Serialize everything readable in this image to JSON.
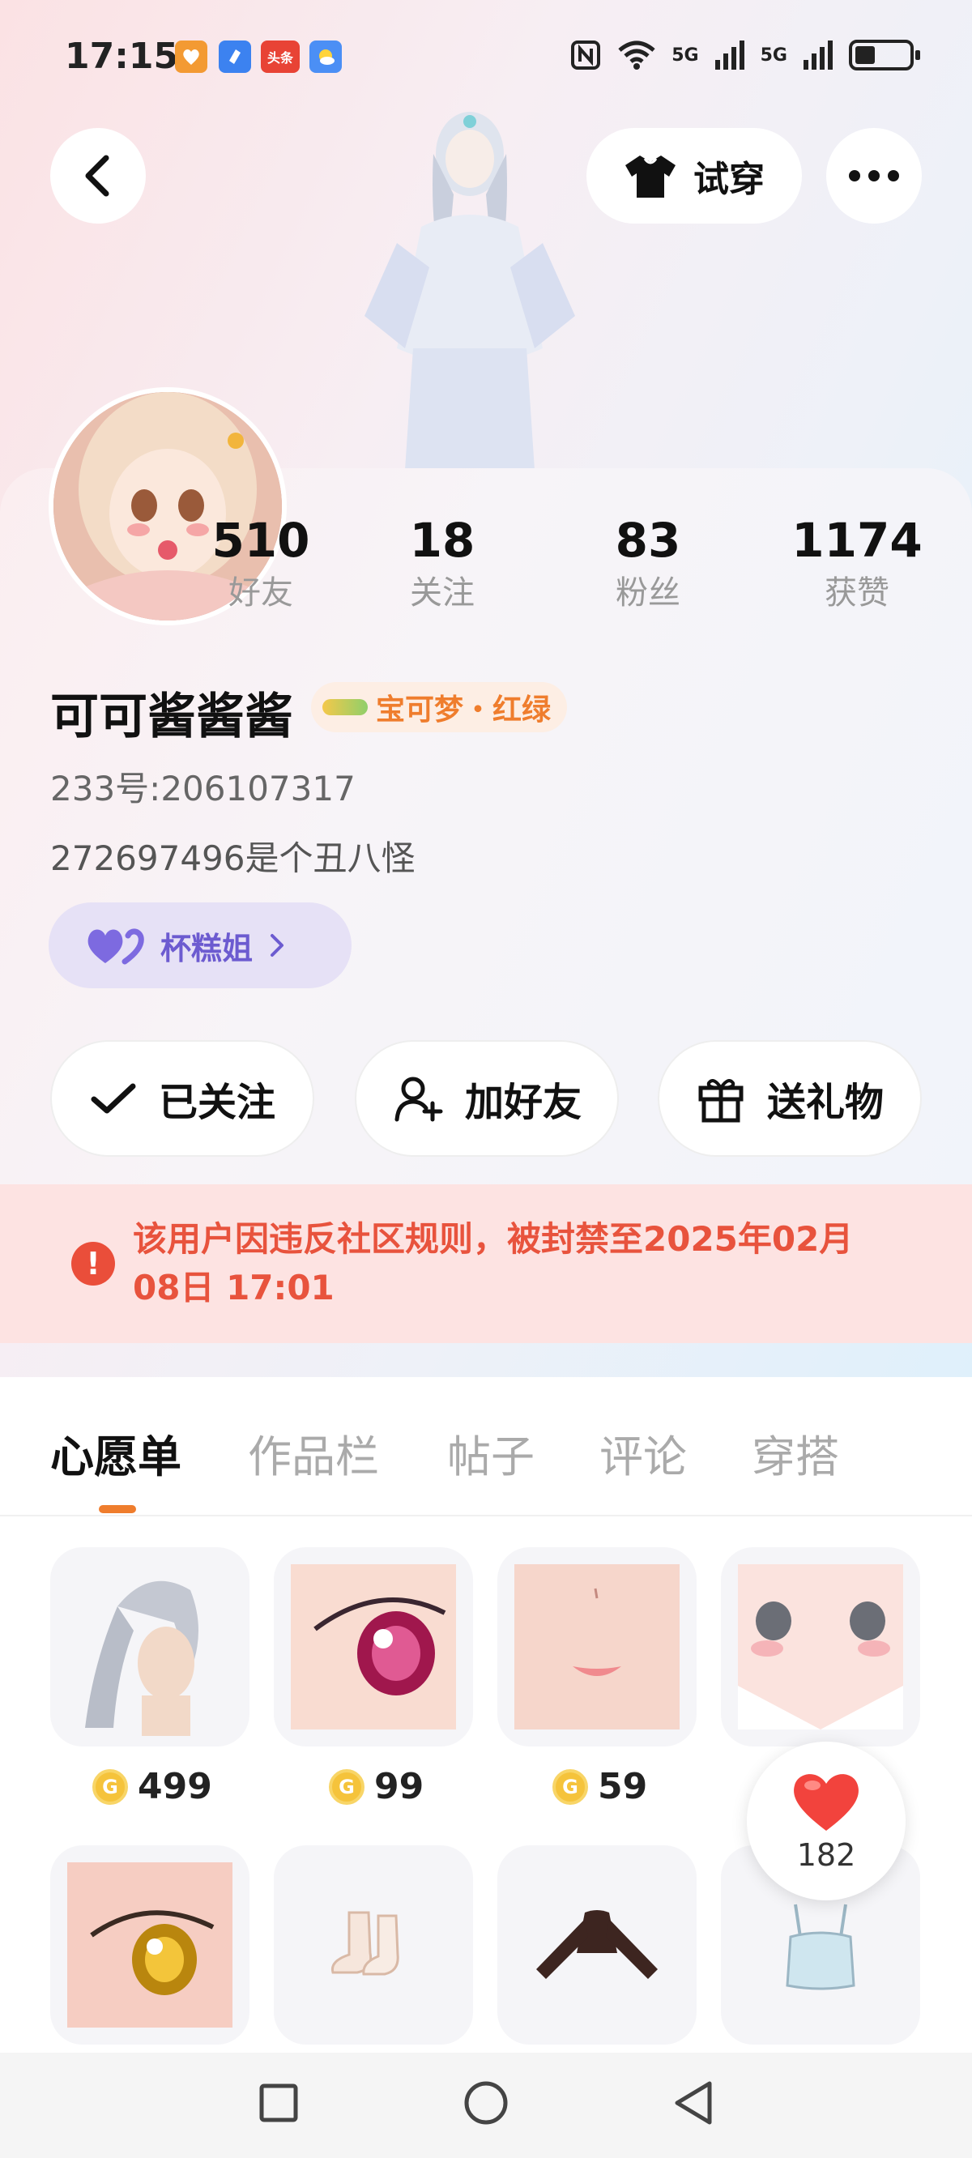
{
  "status_bar": {
    "time": "17:15",
    "app_icons": [
      {
        "icon": "orange-heart-app-icon",
        "color": "#f39a33",
        "label": ""
      },
      {
        "icon": "blue-app-icon",
        "color": "#3c82f0",
        "label": ""
      },
      {
        "icon": "toutiao-app-icon",
        "color": "#e84335",
        "label": "头条"
      },
      {
        "icon": "weather-app-icon",
        "color": "#4b8ff5",
        "label": ""
      }
    ],
    "network": [
      "5G",
      "5G"
    ],
    "battery": "battery-icon"
  },
  "header": {
    "try_on_label": "试穿",
    "back_icon": "chevron-left-icon",
    "more_icon": "more-dots-icon"
  },
  "profile": {
    "stats": [
      {
        "value": "510",
        "label": "好友"
      },
      {
        "value": "18",
        "label": "关注"
      },
      {
        "value": "83",
        "label": "粉丝"
      },
      {
        "value": "1174",
        "label": "获赞"
      }
    ],
    "nickname": "可可酱酱酱",
    "badge": "宝可梦・红绿",
    "uid": "233号:206107317",
    "bio": "272697496是个丑八怪",
    "cp_label": "杯糕姐"
  },
  "actions": {
    "followed": "已关注",
    "add_friend": "加好友",
    "send_gift": "送礼物"
  },
  "ban_notice": {
    "text": "该用户因违反社区规则，被封禁至2025年02月08日 17:01"
  },
  "tabs": [
    "心愿单",
    "作品栏",
    "帖子",
    "评论",
    "穿搭"
  ],
  "wishlist": {
    "prices": [
      "499",
      "99",
      "59"
    ],
    "likes": "182"
  },
  "colors": {
    "accent": "#ef7d2d",
    "ban_bg": "#fde3e2",
    "ban_text": "#e8533d",
    "cp_bg": "#e6e1f6",
    "cp_text": "#6c5bd0"
  }
}
